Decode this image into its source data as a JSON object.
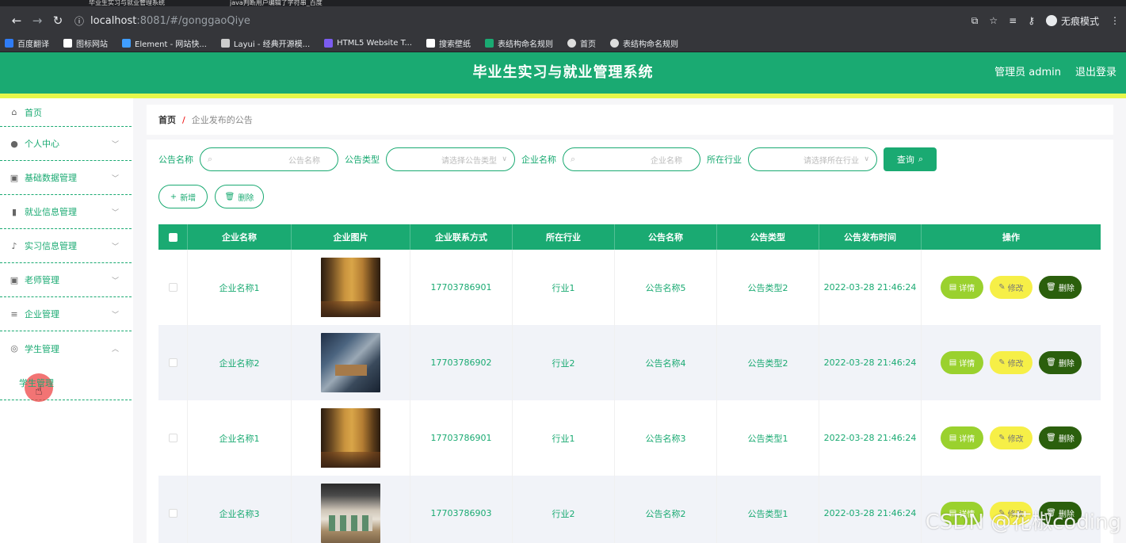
{
  "browser": {
    "tabs": [
      "毕业生实习与就业管理系统",
      "java判断用户编辑了字符串_百度"
    ],
    "url_host": "localhost",
    "url_path": ":8081/#/gonggaoQiye",
    "profile_label": "无痕模式",
    "bookmarks": [
      "百度翻译",
      "图标网站",
      "Element - 网站快...",
      "Layui - 经典开源模...",
      "HTML5 Website T...",
      "搜索壁纸",
      "表结构命名规则",
      "首页",
      "表结构命名规则"
    ]
  },
  "header": {
    "title": "毕业生实习与就业管理系统",
    "user_label": "管理员 admin",
    "logout_label": "退出登录"
  },
  "sidebar": {
    "items": [
      {
        "label": "首页",
        "icon": "home-icon"
      },
      {
        "label": "个人中心",
        "icon": "user-icon"
      },
      {
        "label": "基础数据管理",
        "icon": "clipboard-icon"
      },
      {
        "label": "就业信息管理",
        "icon": "bar-chart-icon"
      },
      {
        "label": "实习信息管理",
        "icon": "microphone-icon"
      },
      {
        "label": "老师管理",
        "icon": "clipboard-icon"
      },
      {
        "label": "企业管理",
        "icon": "menu-icon"
      },
      {
        "label": "学生管理",
        "icon": "compass-icon"
      }
    ],
    "sub_item": "学生管理"
  },
  "breadcrumb": {
    "home": "首页",
    "separator": "/",
    "current": "企业发布的公告"
  },
  "search": {
    "label1": "公告名称",
    "placeholder1": "公告名称",
    "label2": "公告类型",
    "placeholder2": "请选择公告类型",
    "label3": "企业名称",
    "placeholder3": "企业名称",
    "label4": "所在行业",
    "placeholder4": "请选择所在行业",
    "query_label": "查询"
  },
  "actions": {
    "add_label": "新增",
    "delete_label": "删除"
  },
  "table": {
    "headers": [
      "企业名称",
      "企业图片",
      "企业联系方式",
      "所在行业",
      "公告名称",
      "公告类型",
      "公告发布时间",
      "操作"
    ],
    "rows": [
      {
        "company": "企业名称1",
        "image": "gold-lobby",
        "phone": "17703786901",
        "industry": "行业1",
        "notice": "公告名称5",
        "type": "公告类型2",
        "time": "2022-03-28 21:46:24"
      },
      {
        "company": "企业名称2",
        "image": "office",
        "phone": "17703786902",
        "industry": "行业2",
        "notice": "公告名称4",
        "type": "公告类型2",
        "time": "2022-03-28 21:46:24"
      },
      {
        "company": "企业名称1",
        "image": "gold-lobby",
        "phone": "17703786901",
        "industry": "行业1",
        "notice": "公告名称3",
        "type": "公告类型1",
        "time": "2022-03-28 21:46:24"
      },
      {
        "company": "企业名称3",
        "image": "hall",
        "phone": "17703786903",
        "industry": "行业2",
        "notice": "公告名称2",
        "type": "公告类型1",
        "time": "2022-03-28 21:46:24"
      }
    ],
    "op_detail": "详情",
    "op_edit": "修改",
    "op_delete": "删除"
  },
  "watermark": "CSDN @花椒coding",
  "colors": {
    "primary": "#1aaa72",
    "accent_bar": "#e6f74a",
    "detail": "#9ad12e",
    "edit": "#f6ef47",
    "delete": "#2b5f0d"
  }
}
